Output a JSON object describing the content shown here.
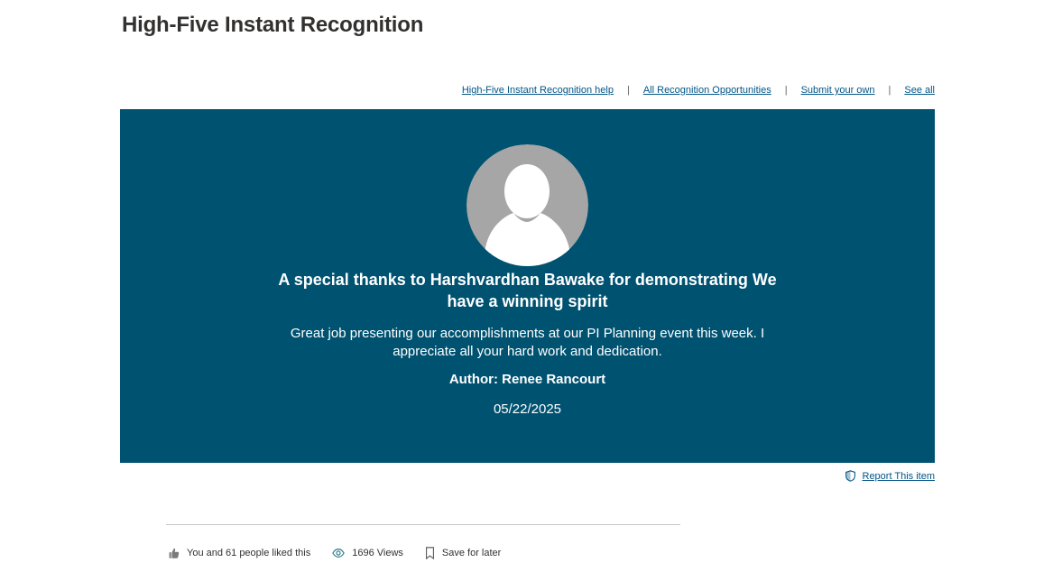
{
  "page": {
    "title": "High-Five Instant Recognition"
  },
  "top_links": {
    "help": "High-Five Instant Recognition help",
    "opportunities": "All Recognition Opportunities",
    "submit": "Submit your own",
    "see_all": "See all",
    "separator": "|"
  },
  "recognition": {
    "headline_prefix": "A special thanks to",
    "recipient": "Harshvardhan Bawake",
    "headline_middle": "for demonstrating",
    "value": "We have a winning spirit",
    "message": "Great job presenting our accomplishments at our PI Planning event this week. I appreciate all your hard work and dedication.",
    "author": "Author: Renee Rancourt",
    "date": "05/22/2025",
    "banner_color": "#005271"
  },
  "report": {
    "label": "Report This item",
    "icon": "shield-icon"
  },
  "social": {
    "likes": "You and 61 people liked this",
    "views": "1696 Views",
    "save": "Save for later",
    "icons": [
      "thumbs-up-icon",
      "eye-icon",
      "bookmark-icon"
    ]
  },
  "colors": {
    "link": "#005587",
    "text": "#323130"
  }
}
